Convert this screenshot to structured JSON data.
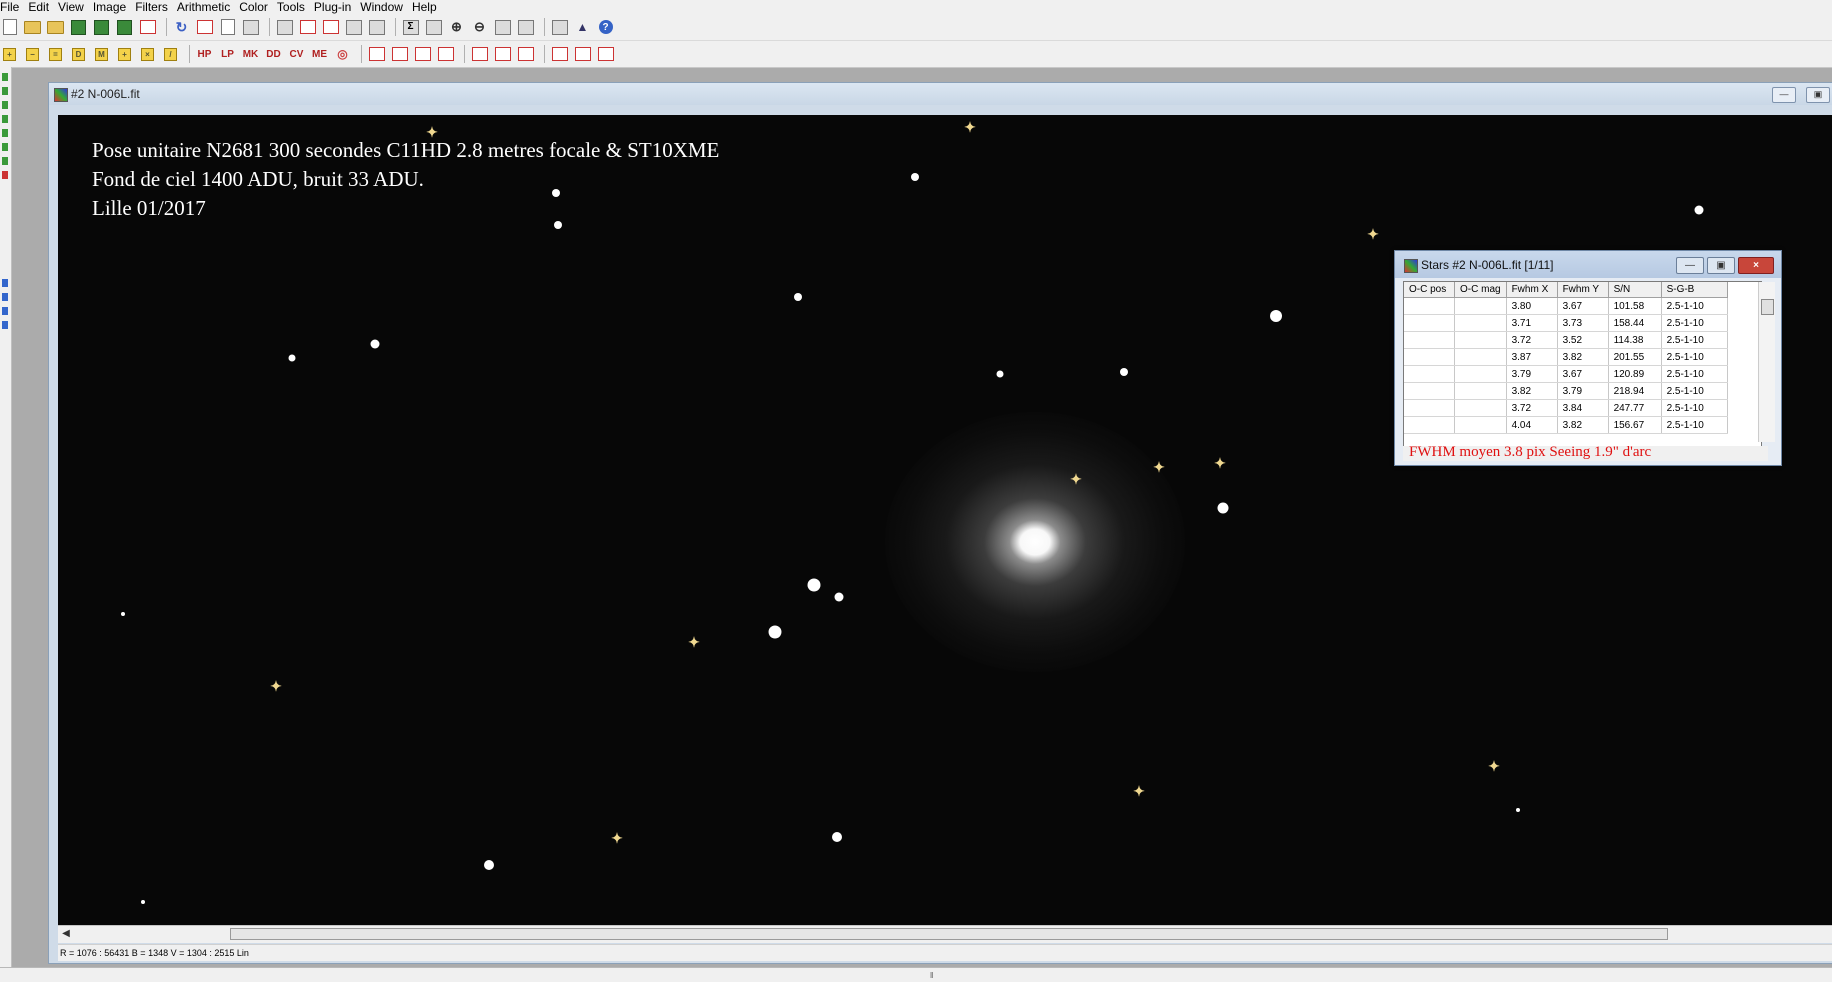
{
  "menu": [
    "File",
    "Edit",
    "View",
    "Image",
    "Filters",
    "Arithmetic",
    "Color",
    "Tools",
    "Plug-in",
    "Window",
    "Help"
  ],
  "toolbar2_labels": [
    "HP",
    "LP",
    "MK",
    "DD",
    "CV",
    "ME"
  ],
  "image_window": {
    "title": "#2 N-006L.fit",
    "caption": [
      "Pose unitaire N2681  300 secondes  C11HD 2.8 metres focale & ST10XME",
      "Fond de ciel 1400 ADU, bruit 33 ADU.",
      "Lille 01/2017"
    ]
  },
  "stars_dialog": {
    "title": "Stars #2 N-006L.fit  [1/11]",
    "columns": [
      "O-C pos",
      "O-C mag",
      "Fwhm X",
      "Fwhm Y",
      "S/N",
      "S-G-B"
    ],
    "rows": [
      [
        "",
        "",
        "3.80",
        "3.67",
        "101.58",
        "2.5-1-10"
      ],
      [
        "",
        "",
        "3.71",
        "3.73",
        "158.44",
        "2.5-1-10"
      ],
      [
        "",
        "",
        "3.72",
        "3.52",
        "114.38",
        "2.5-1-10"
      ],
      [
        "",
        "",
        "3.87",
        "3.82",
        "201.55",
        "2.5-1-10"
      ],
      [
        "",
        "",
        "3.79",
        "3.67",
        "120.89",
        "2.5-1-10"
      ],
      [
        "",
        "",
        "3.82",
        "3.79",
        "218.94",
        "2.5-1-10"
      ],
      [
        "",
        "",
        "3.72",
        "3.84",
        "247.77",
        "2.5-1-10"
      ],
      [
        "",
        "",
        "4.04",
        "3.82",
        "156.67",
        "2.5-1-10"
      ]
    ],
    "footer_note": "FWHM moyen 3.8 pix      Seeing 1.9\" d'arc"
  },
  "status_bar": "R = 1076 : 56431   B = 1348   V = 1304 : 2515 Lin"
}
